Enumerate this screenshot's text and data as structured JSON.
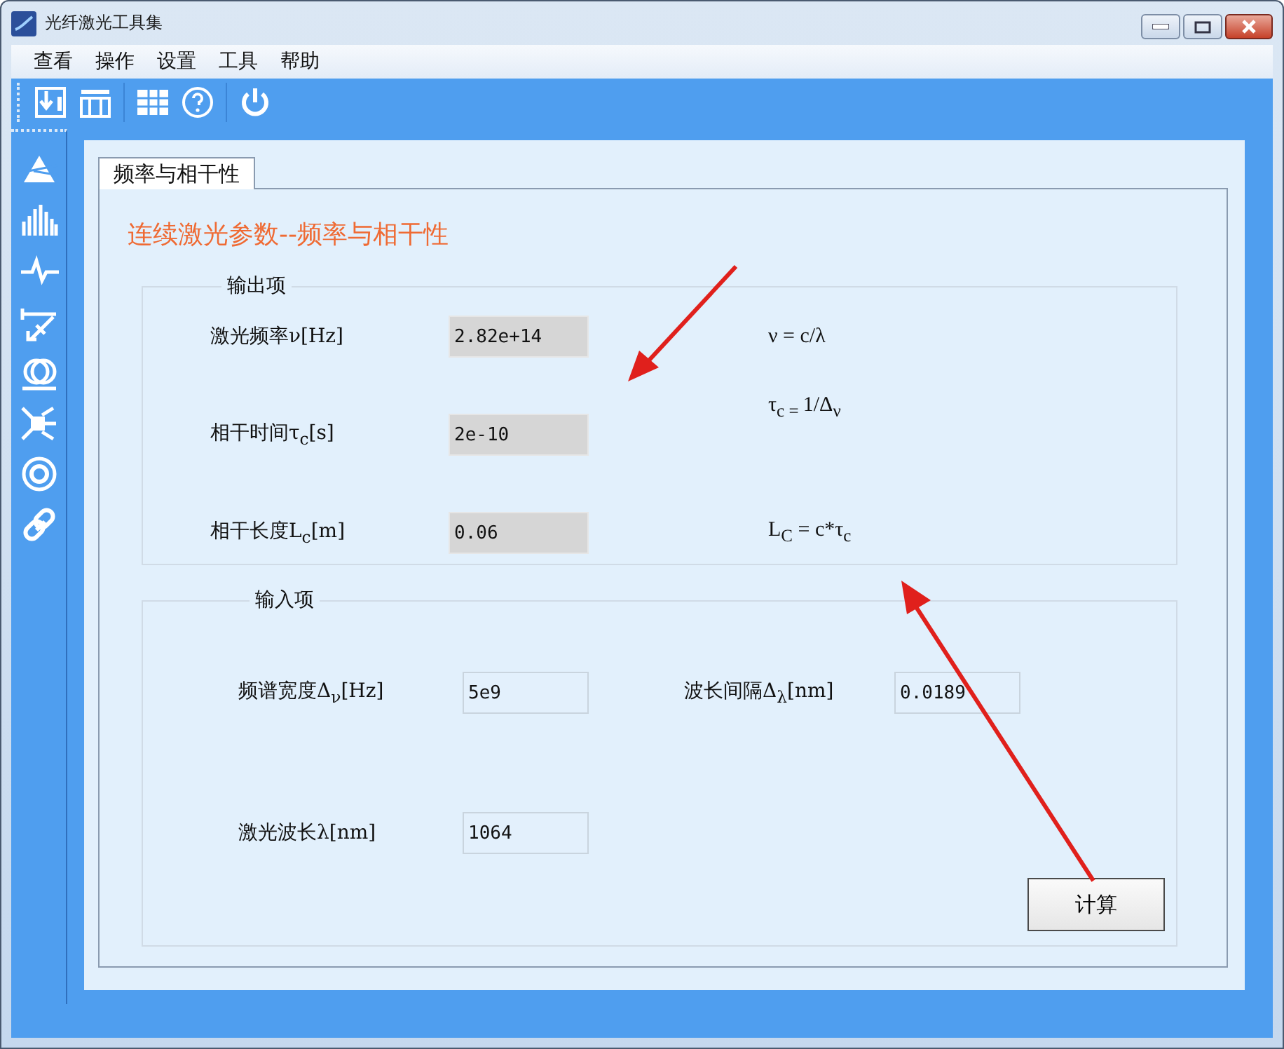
{
  "window": {
    "title": "光纤激光工具集"
  },
  "menu": [
    "查看",
    "操作",
    "设置",
    "工具",
    "帮助"
  ],
  "tabs": [
    {
      "label": "频率与相干性",
      "selected": true
    }
  ],
  "heading": "连续激光参数--频率与相干性",
  "output_group": {
    "title": "输出项",
    "fields": [
      {
        "label": "激光频率ν[Hz]",
        "value": "2.82e+14",
        "readonly": true,
        "formula": "ν = c/λ"
      },
      {
        "label": "相干时间τ$_{c}$[s]",
        "value": "2e-10",
        "readonly": true,
        "formula": "τ$_{c = }$1/Δ$_{ν}$"
      },
      {
        "label": "相干长度L$_{c}$[m]",
        "value": "0.06",
        "readonly": true,
        "formula": "L$_{C}$ = c*τ$_{c}$"
      }
    ]
  },
  "input_group": {
    "title": "输入项",
    "fields": [
      {
        "label": "频谱宽度Δ$_{ν}$[Hz]",
        "value": "5e9",
        "readonly": false
      },
      {
        "label": "波长间隔Δ$_{λ}$[nm]",
        "value": "0.0189",
        "readonly": false
      },
      {
        "label": "激光波长λ[nm]",
        "value": "1064",
        "readonly": false
      }
    ]
  },
  "button": "计算"
}
